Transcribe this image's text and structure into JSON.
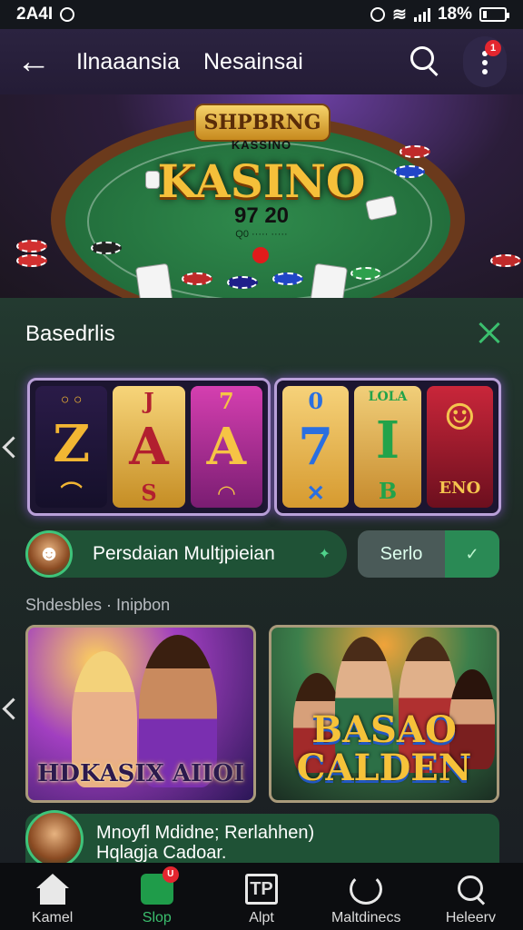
{
  "status_bar": {
    "time": "2A4I",
    "battery": "18%"
  },
  "header": {
    "title_left": "Ilnaaansia",
    "title_right": "Nesainsai",
    "notification_badge": "1"
  },
  "hero": {
    "badge": "SHPBRNG",
    "subtitle": "KASSINO",
    "title": "KASINO",
    "number": "97 20",
    "small_text": "Q0 ·····  ·····"
  },
  "section": {
    "title": "Basedrlis"
  },
  "slot_reels": [
    {
      "top": "◦◦",
      "big": "Z",
      "bottom": "⌒"
    },
    {
      "top": "J",
      "big": "A",
      "bottom": "S"
    },
    {
      "top": "7",
      "big": "A",
      "bottom": "◠"
    },
    {
      "top": "0",
      "big": "7",
      "bottom": "✕"
    },
    {
      "top": "LOLA",
      "big": "I",
      "bottom": "B"
    },
    {
      "top": "☺",
      "big": "",
      "bottom": "ENO"
    }
  ],
  "multiplayer_pill": {
    "label": "Persdaian Multjpieian",
    "chevron": "✦"
  },
  "toggle": {
    "label": "Serlo",
    "value": "✓"
  },
  "subsection": {
    "title": "Shdesbles · Inipbon"
  },
  "game_cards": [
    {
      "title": "HDKASIX AIIOI"
    },
    {
      "title": "BASAO CALDEN"
    }
  ],
  "news": {
    "line1": "Mnoyfl Mdidne; Rerlahhen)",
    "line2": "Hqlagja Cadoar."
  },
  "bottom_nav": [
    {
      "label": "Kamel",
      "icon": "home-icon",
      "badge": ""
    },
    {
      "label": "Slop",
      "icon": "slot-icon",
      "badge": "U"
    },
    {
      "label": "Alpt",
      "icon": "app-icon",
      "badge": ""
    },
    {
      "label": "Maltdinecs",
      "icon": "refresh-icon",
      "badge": ""
    },
    {
      "label": "Heleerv",
      "icon": "search-icon",
      "badge": ""
    }
  ],
  "colors": {
    "accent": "#3bbf6e",
    "header_bg": "#2b2340",
    "panel_bg": "#233a30",
    "badge_red": "#e3262f"
  }
}
